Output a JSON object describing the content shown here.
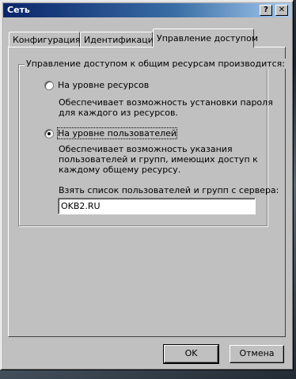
{
  "window": {
    "title": "Сеть",
    "help_btn": "?",
    "close_btn": "✕"
  },
  "tabs": [
    {
      "label": "Конфигурация",
      "active": false
    },
    {
      "label": "Идентификация",
      "active": false
    },
    {
      "label": "Управление доступом",
      "active": true
    }
  ],
  "group": {
    "legend": "Управление доступом к общим ресурсам производится:",
    "option_share": {
      "label": "На уровне ресурсов",
      "desc_line1": "Обеспечивает возможность установки пароля",
      "desc_line2": "для каждого из ресурсов.",
      "selected": false
    },
    "option_user": {
      "label": "На уровне пользователей",
      "desc_line1": "Обеспечивает возможность указания",
      "desc_line2": "пользователей и групп, имеющих доступ к",
      "desc_line3": "каждому общему ресурсу.",
      "selected": true
    },
    "server_label": "Взять список пользователей и групп с сервера:",
    "server_value": "OKB2.RU"
  },
  "buttons": {
    "ok": "OK",
    "cancel": "Отмена"
  }
}
